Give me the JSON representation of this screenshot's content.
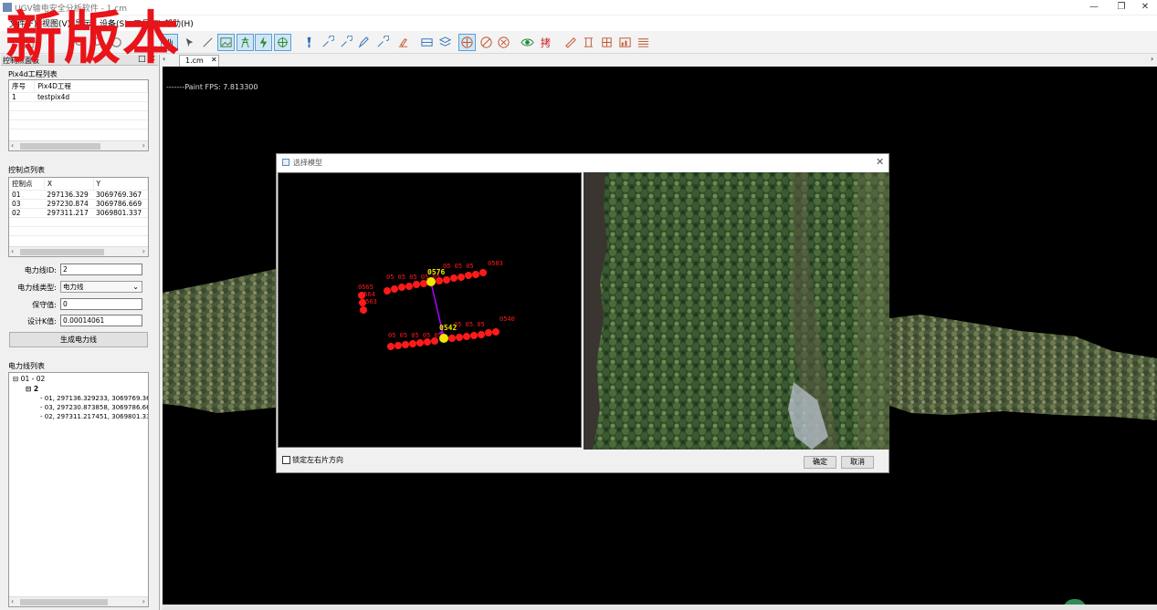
{
  "window": {
    "title": "UGV输电安全分析软件 - 1.cm",
    "minimize_icon": "minimize-icon",
    "restore_icon": "restore-icon",
    "close_icon": "close-icon"
  },
  "watermark": "新版本",
  "menu": [
    "文件(F)",
    "视图(V)",
    "显示",
    "设备(S)",
    "工具(T)",
    "帮助(H)"
  ],
  "toolbar": {
    "icons": [
      "new-icon",
      "open-icon",
      "zoom-in-icon",
      "zoom-out-icon",
      "pan-icon",
      "rotate-icon",
      "hand-icon",
      "select-icon",
      "measure-icon",
      "image-icon",
      "tower-icon",
      "lightning-icon",
      "target-icon",
      "pin-icon",
      "brush-icon",
      "wrench-icon",
      "wrench-alt-icon",
      "edit-icon",
      "layer-icon",
      "stack-icon",
      "crosshair-icon",
      "circle-slash-icon",
      "cancel-circle-icon",
      "eye-icon",
      "analysis-icon",
      "ruler-icon",
      "report-icon",
      "chart-icon",
      "list-icon"
    ]
  },
  "left_panel": {
    "tab_title": "控制点面板",
    "pix4d_section": "Pix4d工程列表",
    "pix4d_columns": [
      "序号",
      "Pix4D工程"
    ],
    "pix4d_rows": [
      [
        "1",
        "testpix4d"
      ]
    ],
    "cp_section": "控制点列表",
    "cp_columns": [
      "控制点",
      "X",
      "Y"
    ],
    "cp_rows": [
      [
        "01",
        "297136.329",
        "3069769.367"
      ],
      [
        "03",
        "297230.874",
        "3069786.669"
      ],
      [
        "02",
        "297311.217",
        "3069801.337"
      ]
    ],
    "form": {
      "line_id_label": "电力线ID:",
      "line_id_value": "2",
      "line_type_label": "电力线类型:",
      "line_type_value": "电力线",
      "safety_label": "保守值:",
      "safety_value": "0",
      "k_label": "设计K值:",
      "k_value": "0.00014061",
      "generate_button": "生成电力线"
    },
    "tree_section": "电力线列表",
    "tree": {
      "root": "01 - 02",
      "child": "2",
      "leaves": [
        "01, 297136.329233, 3069769.366",
        "03, 297230.873858, 3069786.669",
        "02, 297311.217451, 3069801.337"
      ]
    }
  },
  "viewer": {
    "tab_label": "1.cm",
    "fps_text": "-------Paint FPS: 7.813300"
  },
  "dialog": {
    "title": "选择模型",
    "close_icon": "close-icon",
    "lock_label": "锁定左右片方向",
    "ok_button": "确定",
    "cancel_button": "取消",
    "points": {
      "upper_highlight": "0576",
      "lower_highlight": "0542",
      "upper_end": "0583",
      "lower_end": "0540",
      "left_labels": [
        "0565",
        "0564",
        "0563"
      ]
    }
  },
  "colors": {
    "accent": "#5aa0d6",
    "point_red": "#ff1a1a",
    "point_yellow": "#f2e600",
    "link_purple": "#b000ff",
    "watermark_red": "#e8141a"
  }
}
